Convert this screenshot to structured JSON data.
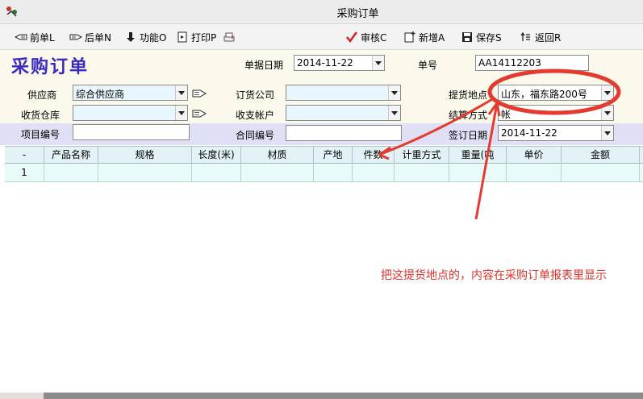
{
  "window": {
    "title": "采购订单"
  },
  "toolbar": {
    "prev": "前单L",
    "next": "后单N",
    "func": "功能O",
    "print": "打印P",
    "audit": "审核C",
    "add": "新增A",
    "save": "保存S",
    "back": "返回R"
  },
  "form": {
    "title": "采购订单",
    "doc_date_label": "单据日期",
    "doc_date_value": "2014-11-22",
    "doc_no_label": "单号",
    "doc_no_value": "AA14112203",
    "supplier_label": "供应商",
    "supplier_value": "综合供应商",
    "order_company_label": "订货公司",
    "order_company_value": "",
    "pickup_label": "提货地点",
    "pickup_value": "山东，福东路200号",
    "warehouse_label": "收货仓库",
    "warehouse_value": "",
    "account_label": "收支帐户",
    "account_value": "",
    "settle_label": "结算方式",
    "settle_value": "帐",
    "project_label": "项目编号",
    "project_value": "",
    "contract_label": "合同编号",
    "contract_value": "",
    "sign_date_label": "签订日期",
    "sign_date_value": "2014-11-22"
  },
  "grid": {
    "columns": [
      "-",
      "产品名称",
      "规格",
      "长度(米)",
      "材质",
      "产地",
      "件数",
      "计重方式",
      "重量(吨",
      "单价",
      "金额"
    ],
    "rows": [
      {
        "index": "1"
      }
    ]
  },
  "annotation": {
    "text": "把这提货地点的，内容在采购订单报表里显示",
    "color": "#e0302a"
  }
}
